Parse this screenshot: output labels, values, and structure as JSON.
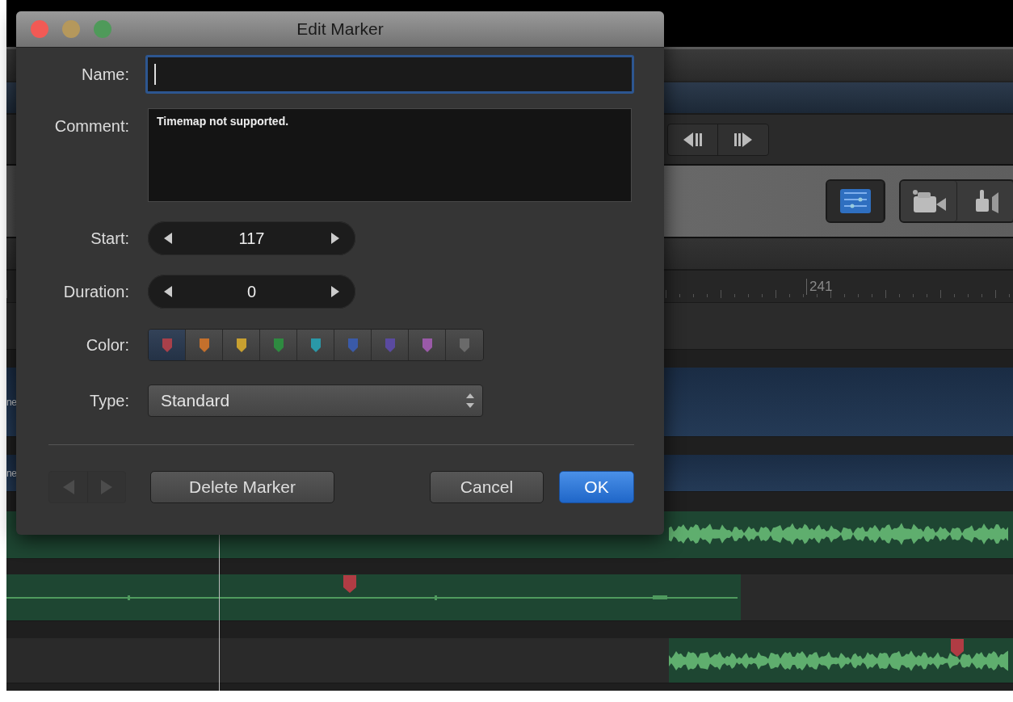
{
  "timeline": {
    "view_buttons": [
      {
        "selected": true
      },
      {
        "selected": false
      },
      {
        "selected": false
      }
    ],
    "ruler": {
      "label": "241"
    },
    "lanes": [
      {
        "kind": "blue",
        "label": "ne"
      },
      {
        "kind": "blue",
        "label": "ne"
      },
      {
        "kind": "audio",
        "marker": false
      },
      {
        "kind": "flat",
        "marker": true
      },
      {
        "kind": "offset",
        "marker": true
      }
    ]
  },
  "dialog": {
    "title": "Edit Marker",
    "name": {
      "label": "Name:",
      "focused": true
    },
    "comment": {
      "label": "Comment:",
      "value": "Timemap not supported."
    },
    "start": {
      "label": "Start:",
      "value": "117"
    },
    "duration": {
      "label": "Duration:",
      "value": "0"
    },
    "color": {
      "label": "Color:",
      "swatches": [
        {
          "color": "#a8404a",
          "selected": true
        },
        {
          "color": "#c4702c",
          "selected": false
        },
        {
          "color": "#c8a030",
          "selected": false
        },
        {
          "color": "#2e8a40",
          "selected": false
        },
        {
          "color": "#2a98a8",
          "selected": false
        },
        {
          "color": "#3a5aa8",
          "selected": false
        },
        {
          "color": "#5a4aa0",
          "selected": false
        },
        {
          "color": "#9a5aa8",
          "selected": false
        },
        {
          "color": "#6a6a6a",
          "selected": false
        }
      ]
    },
    "type": {
      "label": "Type:",
      "value": "Standard"
    },
    "nav_arrows": {
      "disabled": true
    },
    "buttons": [
      {
        "label": "Delete Marker",
        "kind": "normal"
      },
      {
        "label": "Cancel",
        "kind": "normal"
      },
      {
        "label": "OK",
        "kind": "default"
      }
    ]
  }
}
